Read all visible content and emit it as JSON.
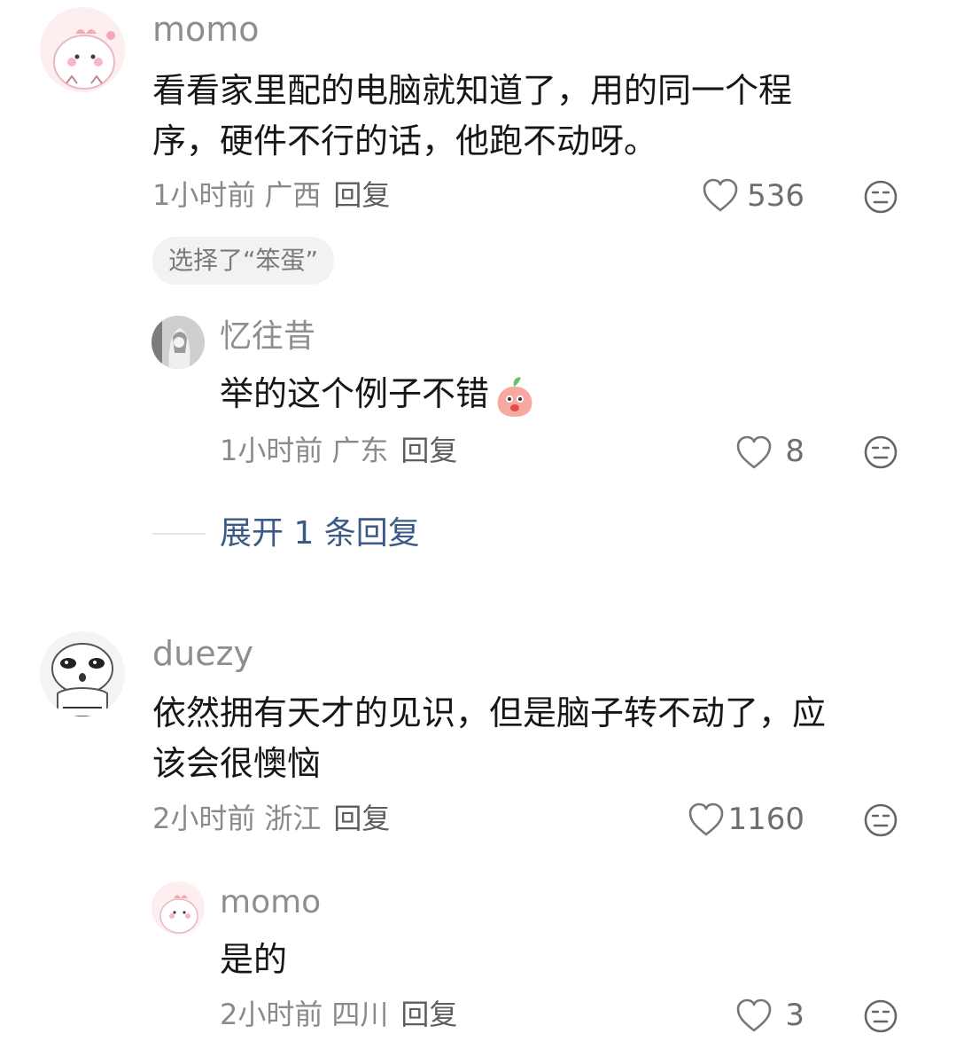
{
  "comments": [
    {
      "user": "momo",
      "text_line1": "看看家里配的电脑就知道了，用的同一个程",
      "text_line2": "序，硬件不行的话，他跑不动呀。",
      "time": "1小时前",
      "location": "广西",
      "reply_label": "回复",
      "likes": "536",
      "chip": "选择了“笨蛋”",
      "replies": [
        {
          "user": "忆往昔",
          "text": "举的这个例子不错",
          "emoji": "peach-emoji",
          "time": "1小时前",
          "location": "广东",
          "reply_label": "回复",
          "likes": "8"
        }
      ],
      "expand_label": "展开 1 条回复"
    },
    {
      "user": "duezy",
      "text_line1": "依然拥有天才的见识，但是脑子转不动了，应",
      "text_line2": "该会很懊恼",
      "time": "2小时前",
      "location": "浙江",
      "reply_label": "回复",
      "likes": "1160",
      "replies": [
        {
          "user": "momo",
          "text": "是的",
          "time": "2小时前",
          "location": "四川",
          "reply_label": "回复",
          "likes": "3"
        }
      ]
    }
  ],
  "icons": {
    "like": "heart-outline-icon",
    "dislike": "neutral-face-icon"
  },
  "colors": {
    "link": "#3c5a86",
    "muted": "#8a8a8a",
    "text": "#161616"
  }
}
